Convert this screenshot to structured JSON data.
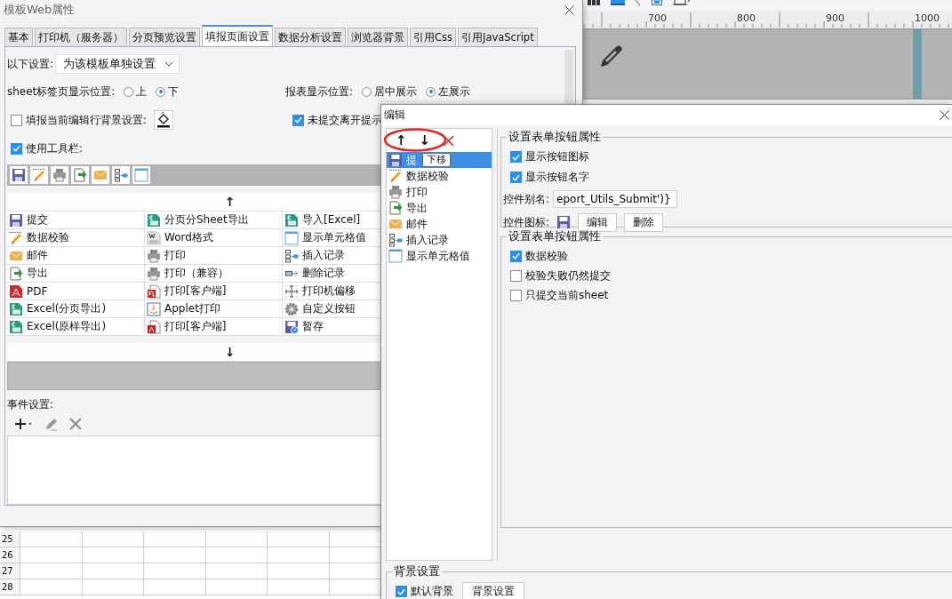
{
  "designer": {
    "ruler_labels": [
      "700",
      "800",
      "900",
      "1000"
    ],
    "row_numbers": [
      "25",
      "26",
      "27",
      "28"
    ]
  },
  "web_dialog": {
    "title": "模板Web属性",
    "tabs": [
      {
        "label": "基本",
        "selected": false
      },
      {
        "label": "打印机（服务器）",
        "selected": false
      },
      {
        "label": "分页预览设置",
        "selected": false
      },
      {
        "label": "填报页面设置",
        "selected": true
      },
      {
        "label": "数据分析设置",
        "selected": false
      },
      {
        "label": "浏览器背景",
        "selected": false
      },
      {
        "label": "引用Css",
        "selected": false
      },
      {
        "label": "引用JavaScript",
        "selected": false
      }
    ],
    "scope": {
      "label": "以下设置:",
      "value": "为该模板单独设置"
    },
    "sheet_tab_position": {
      "label": "sheet标签页显示位置:",
      "options": [
        {
          "label": "上",
          "selected": false
        },
        {
          "label": "下",
          "selected": true
        }
      ]
    },
    "report_position": {
      "label": "报表显示位置:",
      "options": [
        {
          "label": "居中展示",
          "selected": false
        },
        {
          "label": "左展示",
          "selected": true
        }
      ]
    },
    "row_background": {
      "label": "填报当前编辑行背景设置:",
      "checked": false
    },
    "leave_prompt": {
      "label": "未提交离开提示",
      "checked": true
    },
    "use_toolbar": {
      "label": "使用工具栏:",
      "checked": true
    },
    "toolbar_preview": [
      {
        "kind": "save"
      },
      {
        "kind": "verify"
      },
      {
        "kind": "print"
      },
      {
        "kind": "export"
      },
      {
        "kind": "mail"
      },
      {
        "kind": "insert"
      },
      {
        "kind": "cell"
      }
    ],
    "up_arrow": "↑",
    "button_grid": [
      {
        "kind": "save",
        "label": "提交"
      },
      {
        "kind": "excel",
        "label": "分页分Sheet导出"
      },
      {
        "kind": "excel",
        "label": "导入[Excel]"
      },
      {
        "kind": "verify",
        "label": "数据校验"
      },
      {
        "kind": "word",
        "label": "Word格式"
      },
      {
        "kind": "cell",
        "label": "显示单元格值"
      },
      {
        "kind": "mail",
        "label": "邮件"
      },
      {
        "kind": "print",
        "label": "打印"
      },
      {
        "kind": "insert",
        "label": "插入记录"
      },
      {
        "kind": "export",
        "label": "导出"
      },
      {
        "kind": "print",
        "label": "打印（兼容）"
      },
      {
        "kind": "delete",
        "label": "删除记录"
      },
      {
        "kind": "pdf",
        "label": "PDF"
      },
      {
        "kind": "flashprint",
        "label": "打印[客户端]"
      },
      {
        "kind": "move",
        "label": "打印机偏移"
      },
      {
        "kind": "excel",
        "label": "Excel(分页导出)"
      },
      {
        "kind": "applet",
        "label": "Applet打印"
      },
      {
        "kind": "gear",
        "label": "自定义按钮"
      },
      {
        "kind": "excel",
        "label": "Excel(原样导出)"
      },
      {
        "kind": "pdfprint",
        "label": "打印[客户端]"
      },
      {
        "kind": "timer",
        "label": "暂存"
      }
    ],
    "down_arrow": "↓",
    "events": {
      "label": "事件设置:"
    }
  },
  "edit_dialog": {
    "title": "编辑",
    "up_arrow": "↑",
    "down_arrow": "↓",
    "tooltip": "下移",
    "items": [
      {
        "kind": "save",
        "label": "提",
        "selected": true
      },
      {
        "kind": "verify",
        "label": "数据校验",
        "selected": false
      },
      {
        "kind": "print",
        "label": "打印",
        "selected": false
      },
      {
        "kind": "export",
        "label": "导出",
        "selected": false
      },
      {
        "kind": "mail",
        "label": "邮件",
        "selected": false
      },
      {
        "kind": "insert",
        "label": "插入记录",
        "selected": false
      },
      {
        "kind": "cell",
        "label": "显示单元格值",
        "selected": false
      }
    ],
    "button_props": {
      "title": "设置表单按钮属性",
      "show_icon": {
        "label": "显示按钮图标",
        "checked": true
      },
      "show_name": {
        "label": "显示按钮名字",
        "checked": true
      },
      "alias": {
        "label": "控件别名:",
        "value": "eport_Utils_Submit')}"
      },
      "icon": {
        "label": "控件图标:",
        "buttons": [
          "编辑",
          "删除"
        ]
      }
    },
    "form_props": {
      "title": "设置表单按钮属性",
      "options": [
        {
          "label": "数据校验",
          "checked": true
        },
        {
          "label": "校验失败仍然提交",
          "checked": false
        },
        {
          "label": "只提交当前sheet",
          "checked": false
        }
      ]
    },
    "background": {
      "title": "背景设置",
      "default": {
        "label": "默认背景",
        "checked": true
      },
      "button": "背景设置"
    }
  }
}
